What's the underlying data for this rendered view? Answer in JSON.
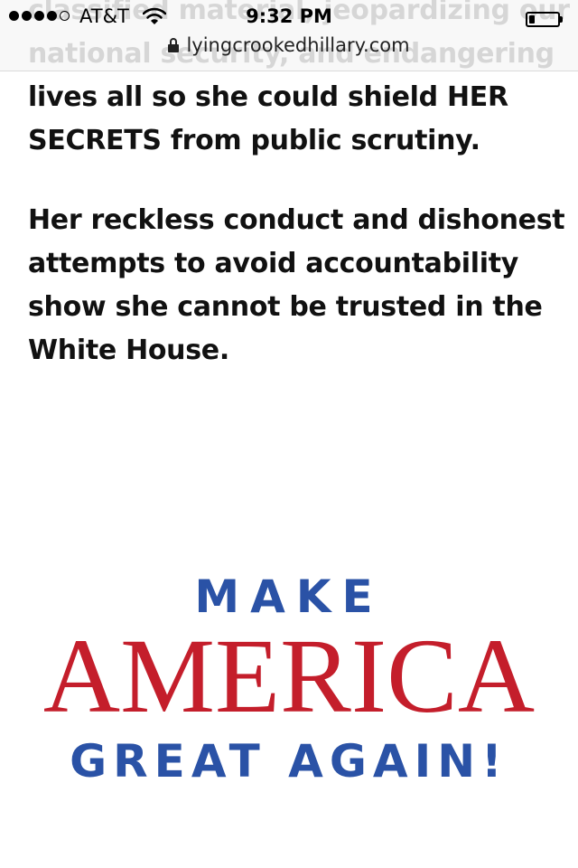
{
  "status_bar": {
    "signal_bars_filled": 4,
    "signal_bars_total": 5,
    "carrier": "AT&T",
    "time": "9:32 PM",
    "battery_level": 0.2
  },
  "address_bar": {
    "url": "lyingcrookedhillary.com"
  },
  "article": {
    "paragraphs": [
      "classified material, jeopardizing our national security, and endangering lives all so she could shield HER SECRETS from public scrutiny.",
      "Her reckless conduct and dishonest attempts to avoid accountability show she cannot be trusted in the White House."
    ]
  },
  "logo": {
    "line1": "MAKE",
    "line2": "AMERICA",
    "line3": "GREAT AGAIN!",
    "colors": {
      "blue": "#2a52a6",
      "red": "#c41e2b"
    }
  }
}
